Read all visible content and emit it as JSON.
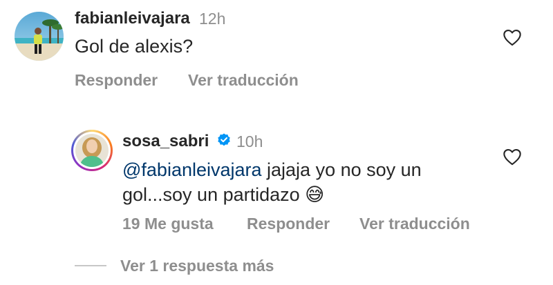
{
  "comment1": {
    "username": "fabianleivajara",
    "time": "12h",
    "text": "Gol de alexis?",
    "actions": {
      "reply": "Responder",
      "translate": "Ver traducción"
    },
    "icons": {
      "like": "heart-outline-icon"
    }
  },
  "comment2": {
    "username": "sosa_sabri",
    "verified_icon": "verified-badge-icon",
    "time": "10h",
    "mention": "@fabianleivajara",
    "text_line1_rest": " jajaja  yo no soy un",
    "text_line2": "gol...soy un partidazo ",
    "emoji": "😅",
    "likes": "19 Me gusta",
    "actions": {
      "reply": "Responder",
      "translate": "Ver traducción"
    },
    "icons": {
      "like": "heart-outline-icon"
    }
  },
  "replies": {
    "view_more": "Ver 1 respuesta más"
  },
  "colors": {
    "text": "#262626",
    "secondary": "#8e8e8e",
    "mention": "#00376b",
    "verified": "#0095f6"
  }
}
